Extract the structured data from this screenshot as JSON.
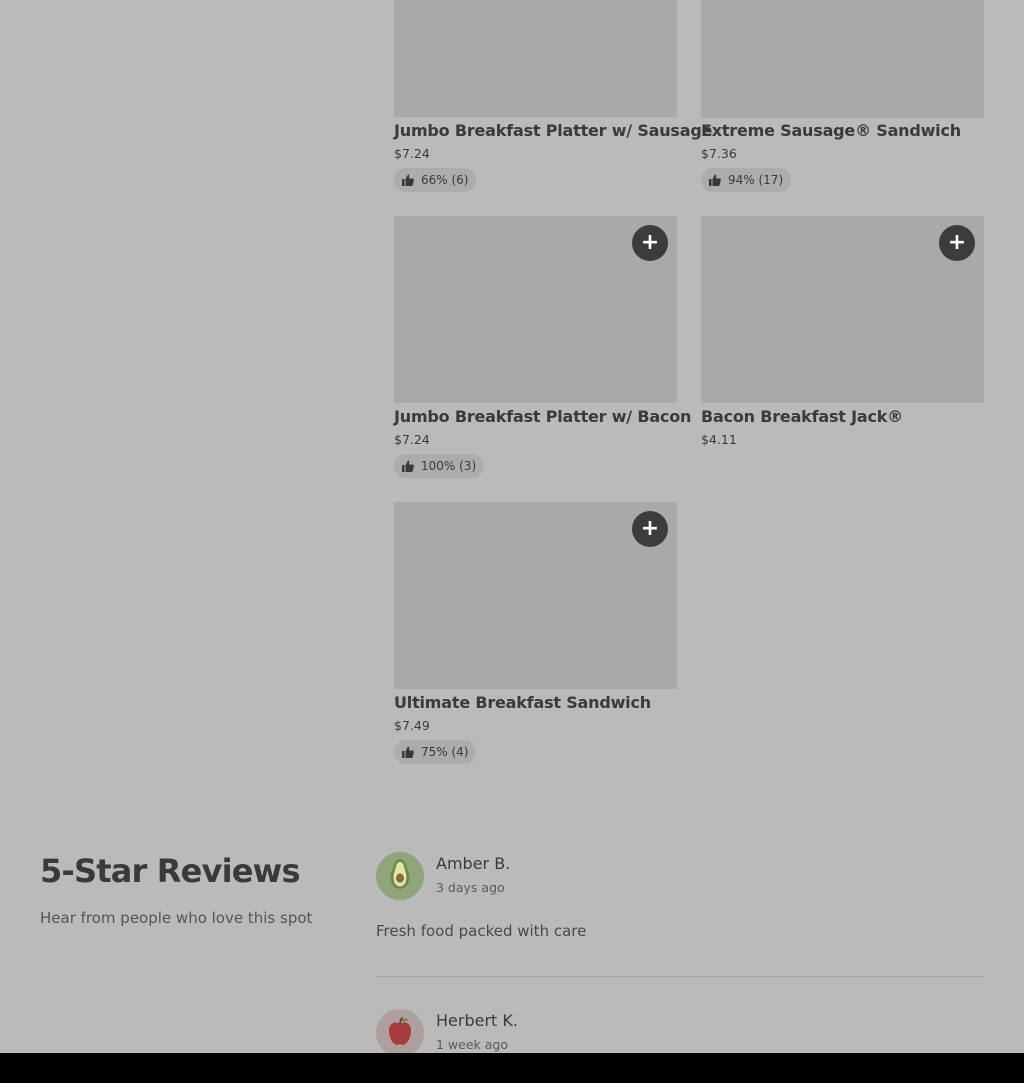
{
  "menu": {
    "items": [
      {
        "name": "Jumbo Breakfast Platter w/ Sausage",
        "price": "$7.24",
        "rating": "66% (6)"
      },
      {
        "name": "Extreme Sausage® Sandwich",
        "price": "$7.36",
        "rating": "94% (17)"
      },
      {
        "name": "Jumbo Breakfast Platter w/ Bacon",
        "price": "$7.24",
        "rating": "100% (3)",
        "add_label": "+"
      },
      {
        "name": "Bacon Breakfast Jack®",
        "price": "$4.11",
        "add_label": "+"
      },
      {
        "name": "Ultimate Breakfast Sandwich",
        "price": "$7.49",
        "rating": "75% (4)",
        "add_label": "+"
      }
    ]
  },
  "reviews": {
    "title": "5-Star Reviews",
    "subtitle": "Hear from people who love this spot",
    "entries": [
      {
        "name": "Amber B.",
        "date": "3 days ago",
        "text": "Fresh food packed with care",
        "avatar_icon": "avocado-icon",
        "avatar_color": "#8fa67a"
      },
      {
        "name": "Herbert K.",
        "date": "1 week ago",
        "text": "",
        "avatar_icon": "apple-icon",
        "avatar_color": "#ad9fa0"
      }
    ]
  },
  "colors": {
    "background": "#bababa",
    "image_placeholder": "#a9a9a9",
    "add_button": "#3c3c3c",
    "rating_pill": "#acacac"
  }
}
